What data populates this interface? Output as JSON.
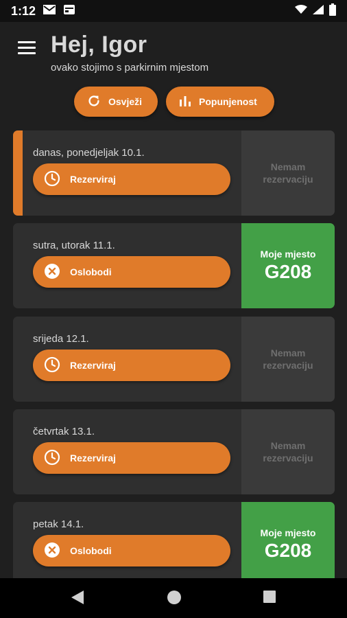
{
  "status": {
    "time": "1:12"
  },
  "header": {
    "title": "Hej, Igor",
    "subtitle": "ovako stojimo s parkirnim mjestom"
  },
  "actions": {
    "refresh_label": "Osvježi",
    "occupancy_label": "Popunjenost"
  },
  "days": [
    {
      "date": "danas, ponedjeljak 10.1.",
      "action": "Rezerviraj",
      "status_line1": "Nemam",
      "status_line2": "rezervaciju"
    },
    {
      "date": "sutra, utorak 11.1.",
      "action": "Oslobodi",
      "status_label": "Moje mjesto",
      "spot": "G208"
    },
    {
      "date": "srijeda 12.1.",
      "action": "Rezerviraj",
      "status_line1": "Nemam",
      "status_line2": "rezervaciju"
    },
    {
      "date": "četvrtak 13.1.",
      "action": "Rezerviraj",
      "status_line1": "Nemam",
      "status_line2": "rezervaciju"
    },
    {
      "date": "petak 14.1.",
      "action": "Oslobodi",
      "status_label": "Moje mjesto",
      "spot": "G208"
    }
  ],
  "colors": {
    "accent": "#e07b2a",
    "spot": "#43a047",
    "card": "#2f2f2f",
    "background": "#1f1f1f"
  }
}
